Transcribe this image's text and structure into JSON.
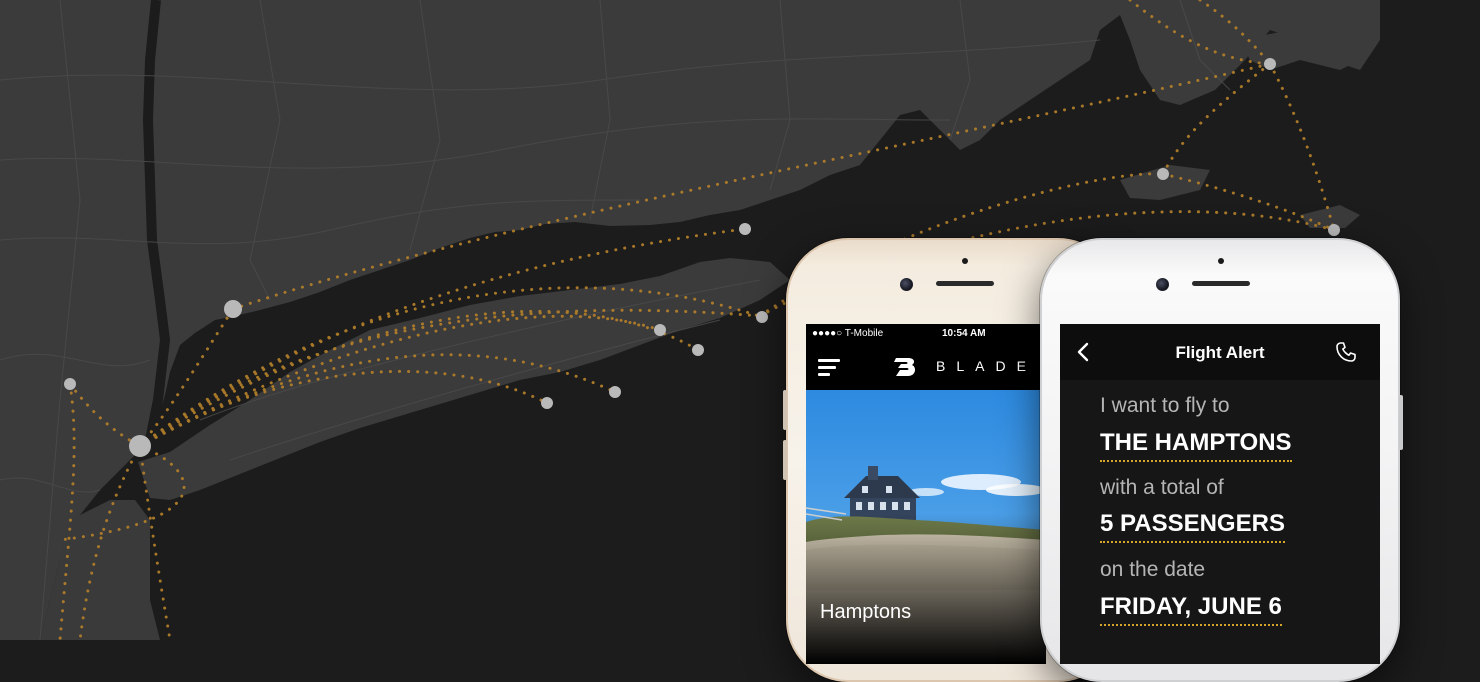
{
  "map": {
    "land_color": "#3b3b3b",
    "water_color": "#1c1c1c",
    "route_color": "#b07d2a",
    "node_color": "#b9b9b9"
  },
  "left_phone": {
    "status_bar": {
      "carrier": "●●●●○ T-Mobile",
      "time": "10:54 AM"
    },
    "brand": "BLADE",
    "menu_icon": "hamburger-menu-icon",
    "destination_card": {
      "label": "Hamptons"
    }
  },
  "right_phone": {
    "header": {
      "title": "Flight Alert",
      "back_icon": "chevron-left-icon",
      "call_icon": "phone-handset-icon"
    },
    "form": {
      "prompt_destination": "I want to fly to",
      "destination": "THE HAMPTONS",
      "prompt_passengers": "with a total of",
      "passengers": "5 PASSENGERS",
      "prompt_date": "on the date",
      "date": "FRIDAY, JUNE 6"
    },
    "accent_color": "#d4a52a"
  }
}
